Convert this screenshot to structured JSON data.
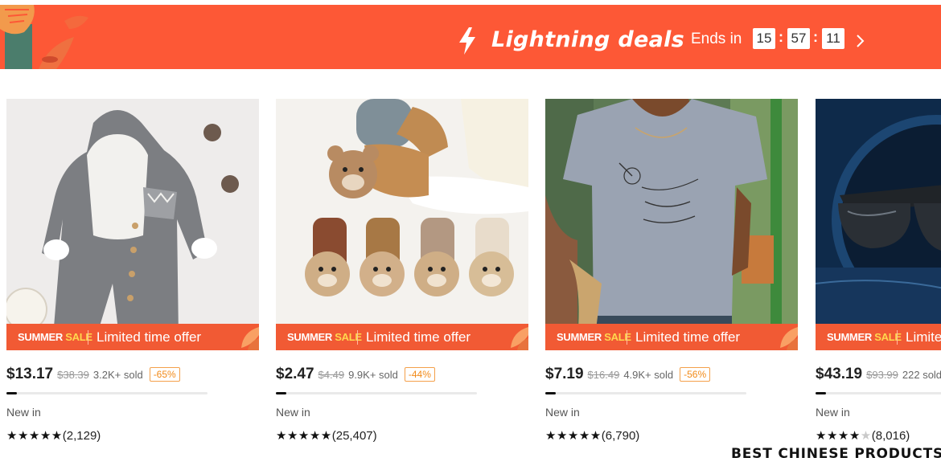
{
  "banner": {
    "title": "Lightning deals",
    "ends_label": "Ends in",
    "timer": {
      "hours": "15",
      "minutes": "57",
      "seconds": "11",
      "separator": ":"
    },
    "colors": {
      "background": "#fd5836",
      "text": "#ffffff"
    },
    "icons": [
      "lightning-bolt-icon",
      "chevron-right-icon"
    ]
  },
  "products": [
    {
      "image": "grey knitted hooded baby romper",
      "sale_tag_left": "SUMMER",
      "sale_tag_right": "SALE",
      "sale_offer": "Limited time offer",
      "price": "$13.17",
      "old_price": "$38.39",
      "sold": "3.2K+ sold",
      "discount": "-65%",
      "progress": 0.05,
      "new_in": "New in",
      "rating": 5,
      "reviews": "(2,129)"
    },
    {
      "image": "teddy bear baby socks",
      "sale_tag_left": "SUMMER",
      "sale_tag_right": "SALE",
      "sale_offer": "Limited time offer",
      "price": "$2.47",
      "old_price": "$4.49",
      "sold": "9.9K+ sold",
      "discount": "-44%",
      "progress": 0.05,
      "new_in": "New in",
      "rating": 5,
      "reviews": "(25,407)"
    },
    {
      "image": "grey just breathe dandelion t-shirt",
      "sale_tag_left": "SUMMER",
      "sale_tag_right": "SALE",
      "sale_offer": "Limited time offer",
      "price": "$7.19",
      "old_price": "$16.49",
      "sold": "4.9K+ sold",
      "discount": "-56%",
      "progress": 0.05,
      "new_in": "New in",
      "rating": 5,
      "reviews": "(6,790)"
    },
    {
      "image": "smart audio sunglasses",
      "sale_tag_left": "SUMMER",
      "sale_tag_right": "SALE",
      "sale_offer": "Limited time offer",
      "price": "$43.19",
      "old_price": "$93.99",
      "sold": "222 sold",
      "discount": "",
      "progress": 0.05,
      "new_in": "New in",
      "rating": 4.5,
      "reviews": "(8,016)"
    }
  ],
  "watermark": "BEST CHINESE PRODUCTS",
  "colors": {
    "accent": "#fd5836",
    "sale_strip": "#f15a34",
    "sale_yellow": "#ffd84d",
    "discount": "#f28a18"
  }
}
